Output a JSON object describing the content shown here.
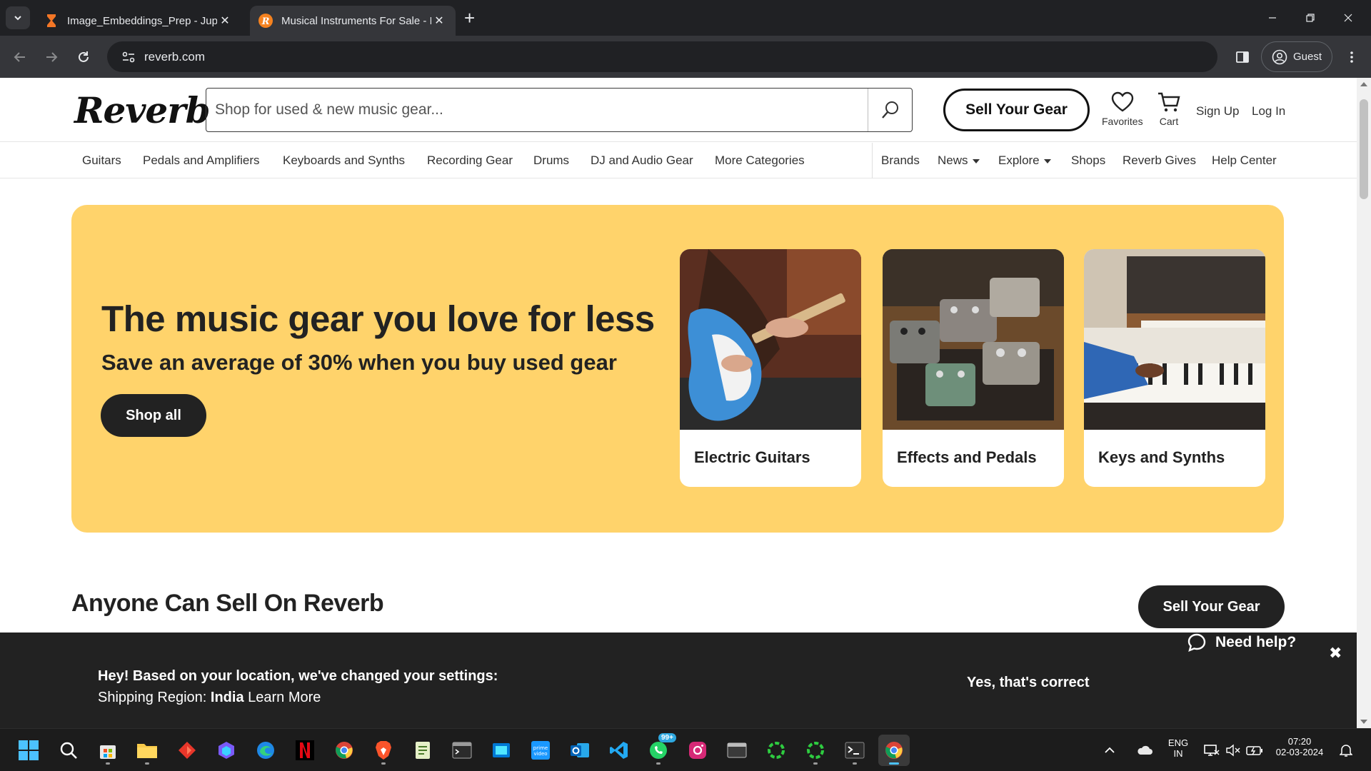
{
  "browser": {
    "tabs": [
      {
        "title": "Image_Embeddings_Prep - Jupy",
        "active": false,
        "favicon": "hourglass-icon"
      },
      {
        "title": "Musical Instruments For Sale - I",
        "active": true,
        "favicon": "reverb-favicon"
      }
    ],
    "url": "reverb.com",
    "profile_label": "Guest"
  },
  "site": {
    "logo": "Reverb",
    "search_placeholder": "Shop for used & new music gear...",
    "sell_label": "Sell Your Gear",
    "favorites_label": "Favorites",
    "cart_label": "Cart",
    "signup_label": "Sign Up",
    "login_label": "Log In",
    "categories": [
      "Guitars",
      "Pedals and Amplifiers",
      "Keyboards and Synths",
      "Recording Gear",
      "Drums",
      "DJ and Audio Gear",
      "More Categories"
    ],
    "secondary_nav": [
      "Brands",
      "News",
      "Explore",
      "Shops",
      "Reverb Gives",
      "Help Center"
    ]
  },
  "hero": {
    "title": "The music gear you love for less",
    "subtitle": "Save an average of 30% when you buy used gear",
    "cta": "Shop all",
    "background_color": "#ffd36b",
    "cards": [
      {
        "caption": "Electric Guitars"
      },
      {
        "caption": "Effects and Pedals"
      },
      {
        "caption": "Keys and Synths"
      }
    ]
  },
  "sell_section": {
    "title": "Anyone Can Sell On Reverb",
    "cta": "Sell Your Gear"
  },
  "location_banner": {
    "message": "Hey! Based on your location, we've changed your settings:",
    "region_label": "Shipping Region:",
    "region_value": "India",
    "learn_more": "Learn More",
    "confirm": "Yes, that's correct",
    "close": "✖",
    "help": "Need help?"
  },
  "taskbar": {
    "apps": [
      "start-icon",
      "search-icon",
      "store-icon",
      "file-explorer-icon",
      "app-icon",
      "copilot-icon",
      "edge-icon",
      "netflix-icon",
      "chrome-icon",
      "brave-icon",
      "notepad-icon",
      "terminal-icon",
      "app-icon",
      "prime-video-icon",
      "outlook-icon",
      "vscode-icon",
      "whatsapp-icon",
      "instagram-icon",
      "app-icon",
      "app-icon",
      "app-icon",
      "terminal-icon",
      "chrome-icon"
    ],
    "whatsapp_badge": "99+",
    "lang_line1": "ENG",
    "lang_line2": "IN",
    "time": "07:20",
    "date": "02-03-2024"
  }
}
